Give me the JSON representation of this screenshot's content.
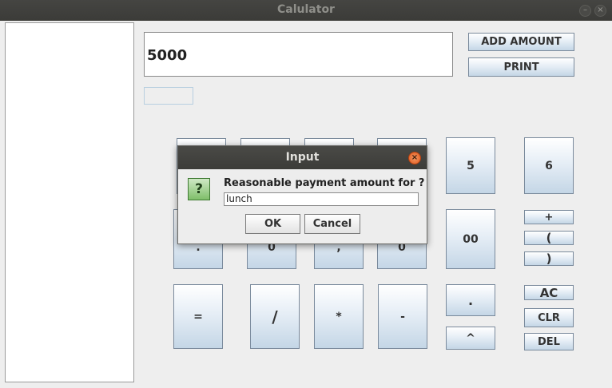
{
  "window": {
    "title": "Calulator",
    "minimize_icon": "minimize-icon",
    "close_icon": "close-icon"
  },
  "display": {
    "value": "5000"
  },
  "actions": {
    "add_amount": "ADD AMOUNT",
    "print": "PRINT"
  },
  "keypad": {
    "five": "5",
    "six": "6",
    "double_zero": "00",
    "plus": "+",
    "open_paren": "(",
    "close_paren": ")",
    "equals": "=",
    "divide": "/",
    "multiply": "*",
    "minus": "-",
    "dot": ".",
    "power": "^",
    "ac": "AC",
    "clr": "CLR",
    "del": "DEL",
    "row2_partial": [
      ".",
      "0",
      ",",
      "0"
    ]
  },
  "dialog": {
    "title": "Input",
    "icon": "question-icon",
    "prompt": "Reasonable payment amount for ?",
    "input_value": "lunch",
    "ok": "OK",
    "cancel": "Cancel"
  }
}
